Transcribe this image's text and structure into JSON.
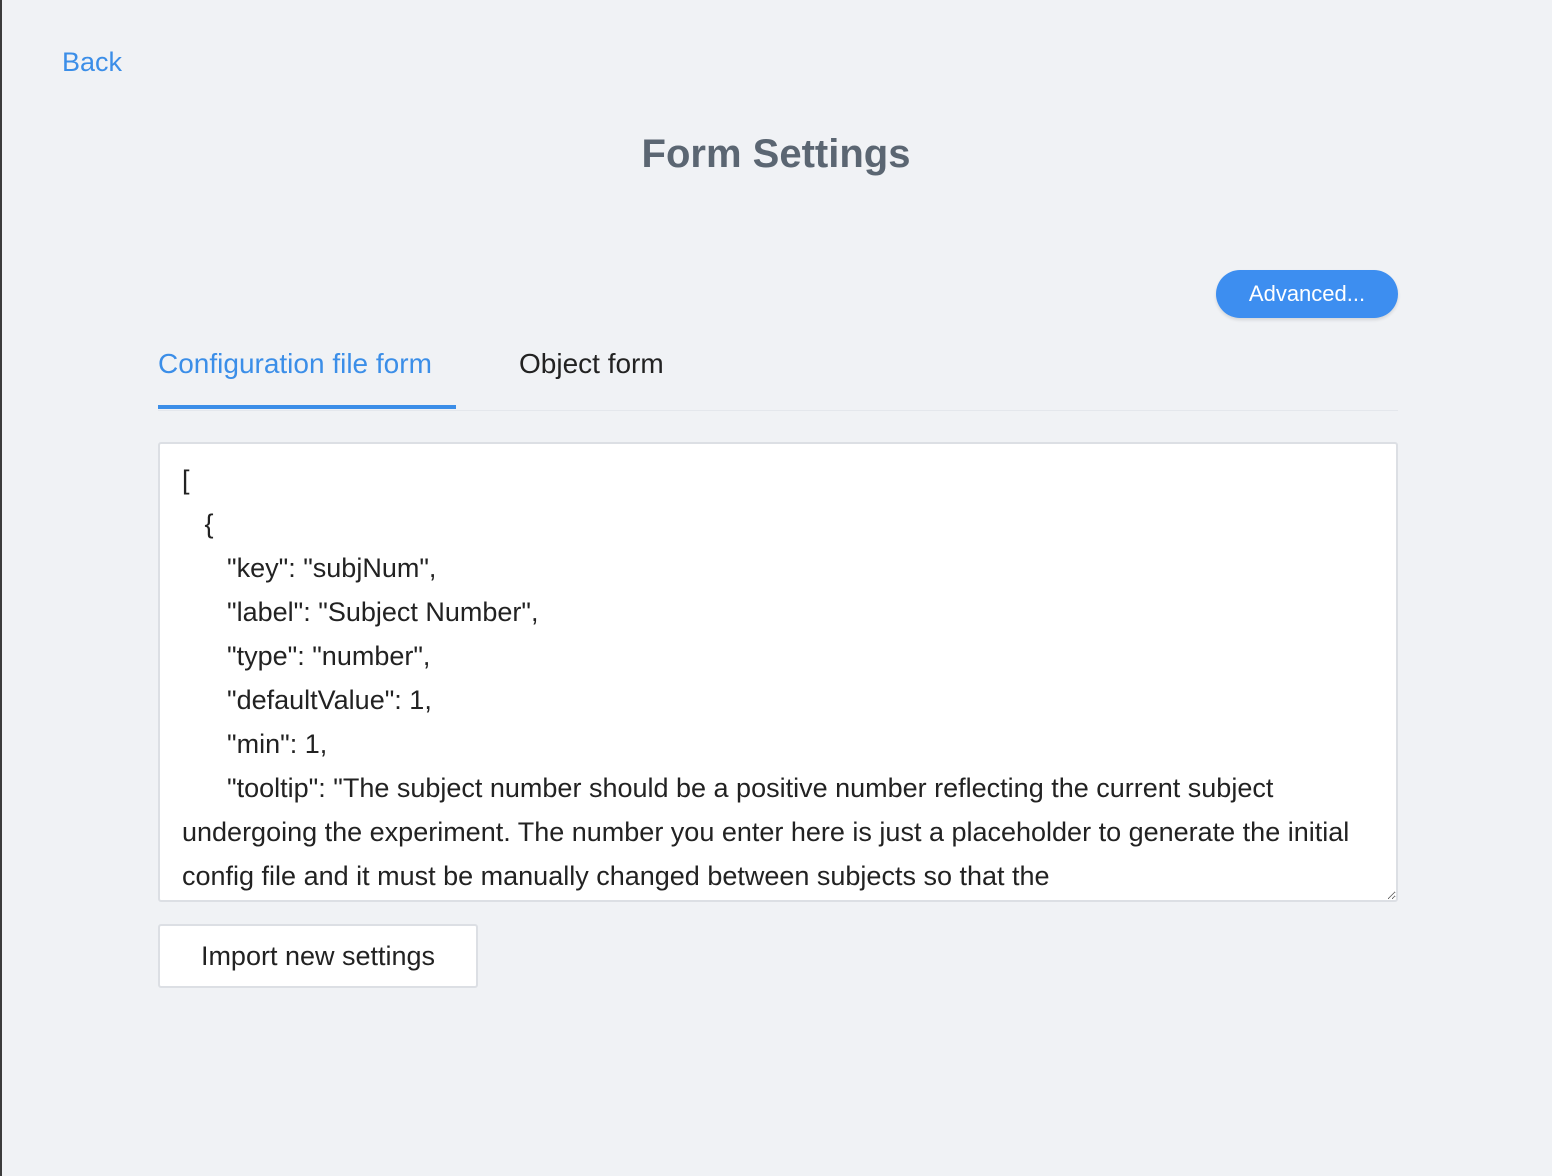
{
  "header": {
    "back_label": "Back",
    "title": "Form Settings"
  },
  "toolbar": {
    "advanced_label": "Advanced..."
  },
  "tabs": [
    {
      "label": "Configuration file form",
      "active": true
    },
    {
      "label": "Object form",
      "active": false
    }
  ],
  "editor": {
    "value": "[\n   {\n      \"key\": \"subjNum\",\n      \"label\": \"Subject Number\",\n      \"type\": \"number\",\n      \"defaultValue\": 1,\n      \"min\": 1,\n      \"tooltip\": \"The subject number should be a positive number reflecting the current subject undergoing the experiment. The number you enter here is just a placeholder to generate the initial config file and it must be manually changed between subjects so that the"
  },
  "actions": {
    "import_label": "Import new settings"
  },
  "colors": {
    "accent": "#3b8ee8",
    "background": "#f0f2f5",
    "title": "#5b6672"
  }
}
